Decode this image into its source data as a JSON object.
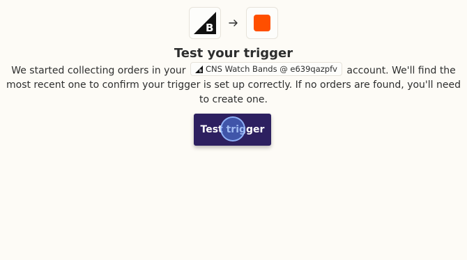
{
  "header": {
    "source_app_icon": "bigcommerce-logo-icon",
    "arrow_icon": "arrow-right-icon",
    "target_app_icon": "orange-square-icon",
    "target_app_color": "#ff4f00"
  },
  "title": "Test your trigger",
  "description": {
    "before_chip": "We started collecting orders in your ",
    "account_chip_label": "CNS Watch Bands @ e639qazpfv",
    "after_chip": " account. We'll find the most recent one to confirm your trigger is set up correctly. If no orders are found, you'll need to create one."
  },
  "button": {
    "label": "Test trigger",
    "color": "#2d2060"
  }
}
